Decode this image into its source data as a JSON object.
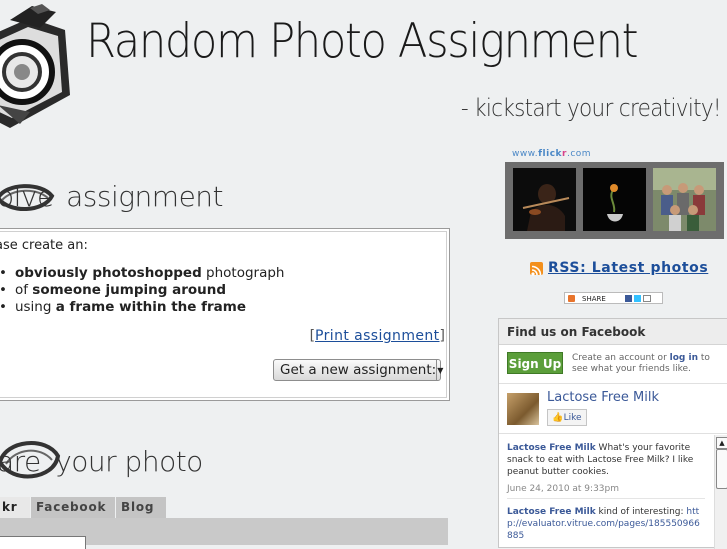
{
  "header": {
    "title": "Random Photo Assignment",
    "tagline": "- kickstart your creativity!"
  },
  "solve": {
    "heading_prefix": "olve",
    "heading_rest": "assignment",
    "intro": "ase create an:",
    "items": [
      {
        "bold": "obviously photoshopped",
        "rest": " photograph",
        "pre": ""
      },
      {
        "pre": "of ",
        "bold": "someone jumping around",
        "rest": ""
      },
      {
        "pre": "using ",
        "bold": "a frame within the frame",
        "rest": ""
      }
    ],
    "print_open": "[",
    "print_label": "Print assignment",
    "print_close": "]",
    "new_button_label": "Get a new assignment:"
  },
  "share": {
    "heading_prefix": "are",
    "heading_rest": "your photo",
    "tabs": [
      "kr",
      "Facebook",
      "Blog"
    ]
  },
  "sidebar": {
    "flickr_www": "www.",
    "flickr_brand_1": "flick",
    "flickr_brand_2": "r",
    "flickr_dotcom": ".com",
    "rss_label": "RSS: Latest photos",
    "share_label": "SHARE",
    "facebook": {
      "header": "Find us on Facebook",
      "signup_label": "Sign Up",
      "signup_text_1": "Create an account or ",
      "signup_login": "log in",
      "signup_text_2": " to see what your friends like.",
      "page_name": "Lactose Free Milk",
      "like_label": "Like",
      "posts": [
        {
          "author": "Lactose Free Milk",
          "text": " What's your favorite snack to eat with Lactose Free Milk? I like peanut butter cookies.",
          "date": "June 24, 2010 at 9:33pm"
        },
        {
          "author": "Lactose Free Milk",
          "text": " kind of interesting: ",
          "link": "http://evaluator.vitrue.com/pages/185550966885"
        }
      ]
    }
  },
  "colors": {
    "link": "#1c4e9a",
    "facebook_blue": "#3b5998",
    "signup_green": "#5b9e3a",
    "rss_orange": "#f3901d"
  }
}
